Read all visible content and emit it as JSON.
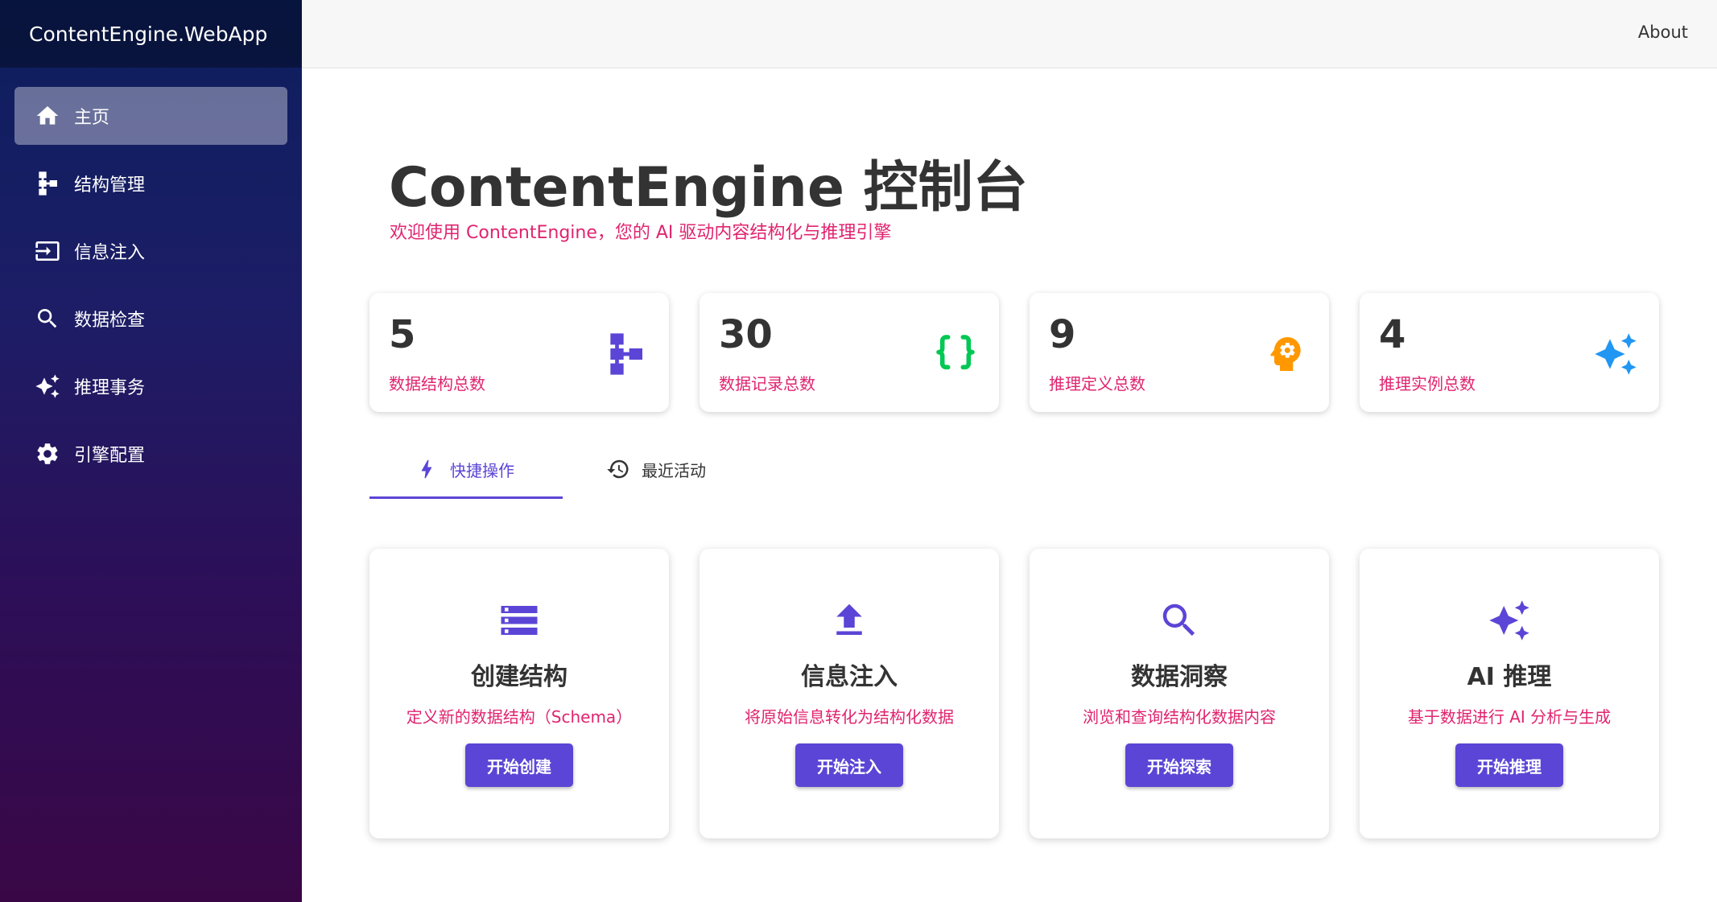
{
  "app": {
    "brand": "ContentEngine.WebApp"
  },
  "topbar": {
    "about": "About"
  },
  "sidebar": {
    "items": [
      {
        "label": "主页",
        "icon": "home-icon",
        "active": true
      },
      {
        "label": "结构管理",
        "icon": "schema-icon"
      },
      {
        "label": "信息注入",
        "icon": "input-icon"
      },
      {
        "label": "数据检查",
        "icon": "search-icon"
      },
      {
        "label": "推理事务",
        "icon": "sparkle-icon"
      },
      {
        "label": "引擎配置",
        "icon": "gear-icon"
      }
    ]
  },
  "page": {
    "title": "ContentEngine 控制台",
    "subtitle": "欢迎使用 ContentEngine，您的 AI 驱动内容结构化与推理引擎"
  },
  "stats": [
    {
      "value": "5",
      "label": "数据结构总数",
      "icon": "schema-icon",
      "color": "#5b45d6"
    },
    {
      "value": "30",
      "label": "数据记录总数",
      "icon": "braces-icon",
      "color": "#00c853"
    },
    {
      "value": "9",
      "label": "推理定义总数",
      "icon": "psychology-icon",
      "color": "#ff9800"
    },
    {
      "value": "4",
      "label": "推理实例总数",
      "icon": "sparkle-icon",
      "color": "#2196f3"
    }
  ],
  "tabs": [
    {
      "label": "快捷操作",
      "icon": "bolt-icon",
      "active": true
    },
    {
      "label": "最近活动",
      "icon": "history-icon"
    }
  ],
  "cards": [
    {
      "title": "创建结构",
      "desc": "定义新的数据结构（Schema）",
      "button": "开始创建",
      "icon": "storage-icon"
    },
    {
      "title": "信息注入",
      "desc": "将原始信息转化为结构化数据",
      "button": "开始注入",
      "icon": "upload-icon"
    },
    {
      "title": "数据洞察",
      "desc": "浏览和查询结构化数据内容",
      "button": "开始探索",
      "icon": "search-icon"
    },
    {
      "title": "AI 推理",
      "desc": "基于数据进行 AI 分析与生成",
      "button": "开始推理",
      "icon": "sparkle-icon"
    }
  ],
  "colors": {
    "accent": "#5b45d6",
    "pink": "#e0246f"
  }
}
